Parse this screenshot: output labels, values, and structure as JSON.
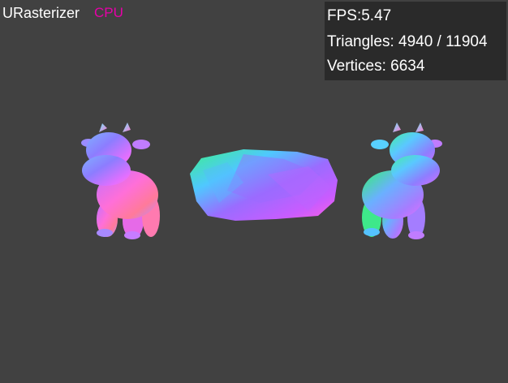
{
  "app": {
    "title": "URasterizer",
    "mode": "CPU",
    "mode_color": "#e600a8"
  },
  "stats": {
    "fps": "FPS:5.47",
    "triangles": "Triangles: 4940 / 11904",
    "vertices": "Vertices: 6634"
  },
  "scene": {
    "background_color": "#414141",
    "objects": [
      "cow-model",
      "rock-model",
      "cow-model"
    ]
  }
}
